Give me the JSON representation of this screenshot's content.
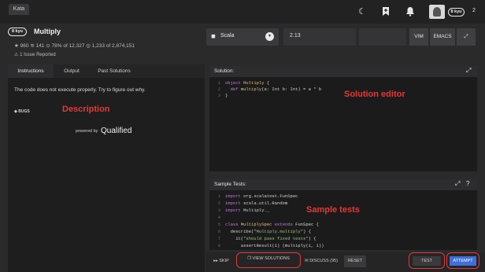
{
  "header": {
    "kata_tab": "Kata",
    "rank": "8 kyu",
    "user_rank": "8 kyu",
    "notif_count": "2"
  },
  "kata": {
    "rank": "8 kyu",
    "title": "Multiply",
    "stats": {
      "bookmarks": "960",
      "stars": "141",
      "rate": "78% of 12,327",
      "completions": "1,233 of 2,874,151"
    },
    "issues": "1 Issue Reported"
  },
  "language": {
    "label": "Scala"
  },
  "version": {
    "label": "2.13"
  },
  "modes": {
    "vim": "VIM",
    "emacs": "EMACS"
  },
  "tabs": [
    "Instructions",
    "Output",
    "Past Solutions"
  ],
  "description": {
    "text": "The code does not execute properly. Try to figure out why.",
    "tag": "BUGS",
    "annotation": "Description",
    "powered_by": "powered by",
    "brand": "Qualified"
  },
  "solution": {
    "header": "Solution:",
    "annotation": "Solution editor",
    "lines": [
      "object Multiply {",
      "  def multiply(a: Int b: Int) = a * b",
      "}"
    ]
  },
  "tests": {
    "header": "Sample Tests:",
    "annotation": "Sample tests",
    "lines": [
      "import org.scalatest.FunSpec",
      "import scala.util.Random",
      "import Multiply._",
      "",
      "class MultiplySpec extends FunSpec {",
      "  describe(\"Multiply.multiply\") {",
      "    it(\"should pass fixed tests\") {",
      "      assertResult(1) (multiply(1, 1))"
    ]
  },
  "actions": {
    "skip": "SKIP",
    "view_solutions": "VIEW SOLUTIONS",
    "discuss": "DISCUSS (95)",
    "reset": "RESET",
    "test": "TEST",
    "attempt": "ATTEMPT"
  },
  "colors": {
    "annotation": "#e53935",
    "attempt": "#3f6fd8"
  }
}
